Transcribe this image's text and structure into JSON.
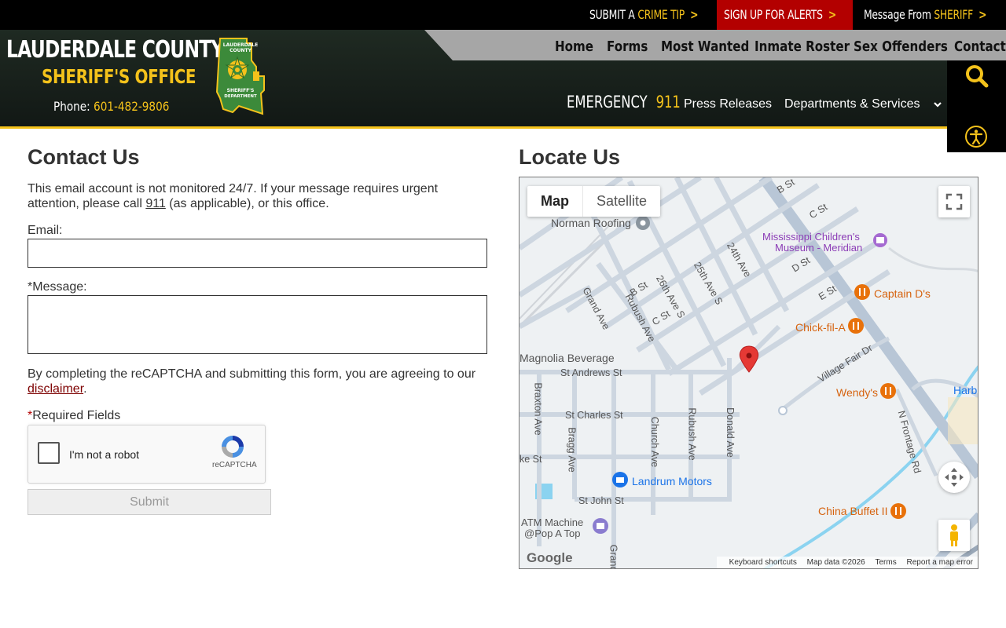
{
  "topbar": {
    "crime_tip_prefix": "SUBMIT A",
    "crime_tip_accent": "CRIME TIP",
    "alerts_label": "SIGN UP FOR ALERTS",
    "sheriff_prefix": "Message From",
    "sheriff_accent": "SHERIFF",
    "chevron": ">"
  },
  "brand": {
    "title": "LAUDERDALE COUNTY",
    "subtitle": "SHERIFF'S OFFICE",
    "phone_label": "Phone:",
    "phone_number": "601-482-9806",
    "badge_top": "LAUDERDALE COUNTY",
    "badge_bottom": "SHERIFF'S DEPARTMENT"
  },
  "nav": {
    "items": [
      "Home",
      "Forms",
      "Most Wanted",
      "Inmate Roster",
      "Sex Offenders",
      "Contact"
    ],
    "emergency_label": "EMERGENCY",
    "emergency_number": "911",
    "press_releases": "Press Releases",
    "departments": "Departments & Services"
  },
  "contact": {
    "title": "Contact Us",
    "note_before": "This email account is not monitored 24/7. If your message requires urgent attention, please call ",
    "note_link": "911",
    "note_after": " (as applicable), or this office.",
    "email_label": "Email:",
    "message_label": "Message:",
    "required_star": "*",
    "consent_before": "By completing the reCAPTCHA and submitting this form, you are agreeing to our ",
    "consent_link": "disclaimer",
    "consent_after": ".",
    "required_fields": "Required Fields",
    "captcha_text": "I'm not a robot",
    "captcha_brand": "reCAPTCHA",
    "submit": "Submit"
  },
  "map": {
    "title": "Locate Us",
    "type_map": "Map",
    "type_satellite": "Satellite",
    "labels": {
      "norman_roofing": "Norman Roofing",
      "museum_1": "Mississippi Children's",
      "museum_2": "Museum - Meridian",
      "captain_ds": "Captain D's",
      "chick_fil_a": "Chick-fil-A",
      "wendys": "Wendy's",
      "harbor": "Harbor",
      "china_buffet": "China Buffet II",
      "landrum": "Landrum Motors",
      "atm_1": "ATM Machine",
      "atm_2": "@Pop A Top",
      "magnolia": "Magnolia Beverage"
    },
    "streets": {
      "b_st_top": "B St",
      "c_st_top": "C St",
      "d_st": "D St",
      "e_st": "E St",
      "ave_24": "24th Ave",
      "ave_25": "25th Ave S",
      "ave_26": "26th Ave S",
      "b_st": "B St",
      "c_st": "C St",
      "grand_ave": "Grand Ave",
      "rubush_ave_top": "Rubush Ave",
      "village_fair": "Village Fair Dr",
      "st_andrews": "St Andrews St",
      "braxton": "Braxton Ave",
      "st_charles": "St Charles St",
      "bragg": "Bragg Ave",
      "church": "Church Ave",
      "rubush_ave": "Rubush Ave",
      "donald": "Donald Ave",
      "n_frontage": "N Frontage Rd",
      "ke_st": "ke St",
      "st_john": "St John St",
      "grand_bottom": "Grand"
    },
    "google": "Google",
    "footer": [
      "Keyboard shortcuts",
      "Map data ©2026",
      "Terms",
      "Report a map error"
    ]
  },
  "colors": {
    "gold": "#f4c21b",
    "alert_red": "#b30000",
    "header_green": "#1f2a22",
    "pin_red": "#e53935",
    "poi_orange": "#e8710a"
  }
}
